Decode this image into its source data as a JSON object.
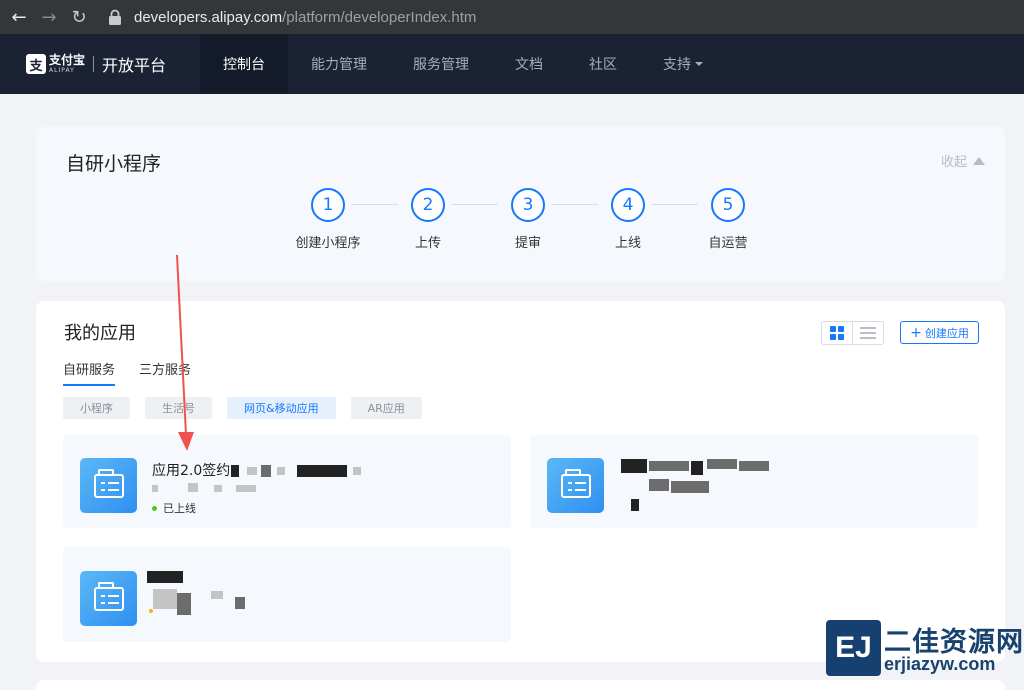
{
  "browser": {
    "url_domain": "developers.alipay.com",
    "url_path": "/platform/developerIndex.htm"
  },
  "header": {
    "logo_cn": "支付宝",
    "logo_en": "ALIPAY",
    "platform_title": "开放平台",
    "tabs": [
      {
        "label": "控制台",
        "active": true
      },
      {
        "label": "能力管理"
      },
      {
        "label": "服务管理"
      },
      {
        "label": "文档"
      },
      {
        "label": "社区"
      },
      {
        "label": "支持"
      }
    ]
  },
  "guide": {
    "title": "自研小程序",
    "collapse_label": "收起",
    "steps": [
      {
        "num": "1",
        "label": "创建小程序"
      },
      {
        "num": "2",
        "label": "上传"
      },
      {
        "num": "3",
        "label": "提审"
      },
      {
        "num": "4",
        "label": "上线"
      },
      {
        "num": "5",
        "label": "自运营"
      }
    ]
  },
  "my_apps": {
    "title": "我的应用",
    "create_label": "创建应用",
    "subtabs": [
      "自研服务",
      "三方服务"
    ],
    "categories": [
      "小程序",
      "生活号",
      "网页&移动应用",
      "AR应用"
    ],
    "active_category": "网页&移动应用",
    "apps": [
      {
        "name": "应用2.0签约",
        "status": "已上线"
      }
    ]
  },
  "watermark": {
    "logo": "EJ",
    "cn": "二佳资源网",
    "en": "erjiazyw.com"
  },
  "colors": {
    "accent": "#1677ff",
    "nav_bg": "#1b2233",
    "status_online": "#52c41a",
    "annotation_arrow": "#f0524f"
  }
}
